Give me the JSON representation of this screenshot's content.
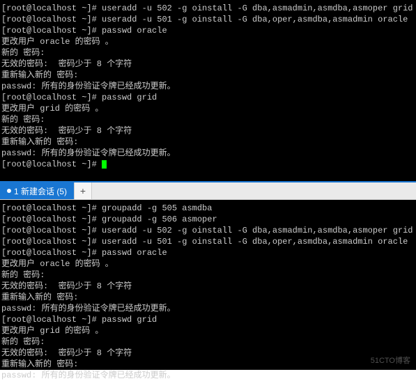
{
  "top_pane": {
    "lines": [
      "[root@localhost ~]# useradd -u 502 -g oinstall -G dba,asmadmin,asmdba,asmoper grid",
      "[root@localhost ~]# useradd -u 501 -g oinstall -G dba,oper,asmdba,asmadmin oracle",
      "[root@localhost ~]# passwd oracle",
      "更改用户 oracle 的密码 。",
      "新的 密码:",
      "无效的密码:  密码少于 8 个字符",
      "重新输入新的 密码:",
      "passwd: 所有的身份验证令牌已经成功更新。",
      "[root@localhost ~]# passwd grid",
      "更改用户 grid 的密码 。",
      "新的 密码:",
      "无效的密码:  密码少于 8 个字符",
      "重新输入新的 密码:",
      "passwd: 所有的身份验证令牌已经成功更新。",
      "[root@localhost ~]# "
    ]
  },
  "tab": {
    "label": "1 新建会话 (5)"
  },
  "new_tab_label": "+",
  "bottom_pane": {
    "lines": [
      "[root@localhost ~]# groupadd -g 505 asmdba",
      "[root@localhost ~]# groupadd -g 506 asmoper",
      "[root@localhost ~]# useradd -u 502 -g oinstall -G dba,asmadmin,asmdba,asmoper grid",
      "[root@localhost ~]# useradd -u 501 -g oinstall -G dba,oper,asmdba,asmadmin oracle",
      "[root@localhost ~]# passwd oracle",
      "更改用户 oracle 的密码 。",
      "新的 密码:",
      "无效的密码:  密码少于 8 个字符",
      "重新输入新的 密码:",
      "passwd: 所有的身份验证令牌已经成功更新。",
      "[root@localhost ~]# passwd grid",
      "更改用户 grid 的密码 。",
      "新的 密码:",
      "无效的密码:  密码少于 8 个字符",
      "重新输入新的 密码:",
      "passwd: 所有的身份验证令牌已经成功更新。"
    ]
  },
  "watermark": "51CTO博客"
}
